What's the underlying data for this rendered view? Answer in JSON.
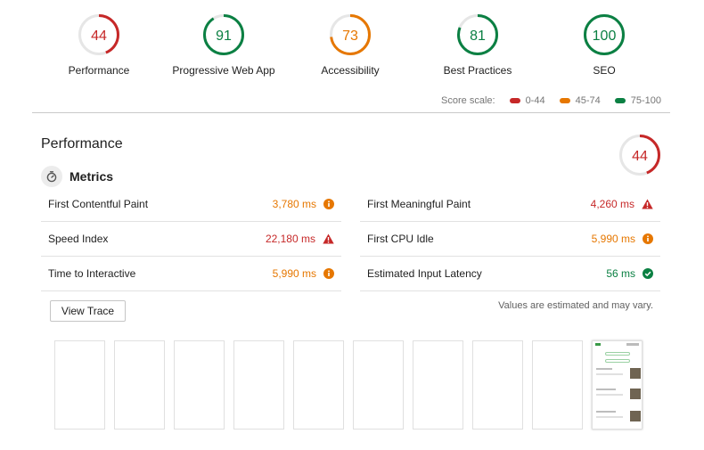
{
  "colors": {
    "pass": "#0b8043",
    "average": "#e67700",
    "fail": "#c62828",
    "track": "#e6e6e6"
  },
  "gauges": [
    {
      "score": 44,
      "label": "Performance",
      "rating": "fail"
    },
    {
      "score": 91,
      "label": "Progressive Web App",
      "rating": "pass"
    },
    {
      "score": 73,
      "label": "Accessibility",
      "rating": "average"
    },
    {
      "score": 81,
      "label": "Best Practices",
      "rating": "pass"
    },
    {
      "score": 100,
      "label": "SEO",
      "rating": "pass"
    }
  ],
  "score_scale": {
    "label": "Score scale:",
    "ranges": [
      {
        "text": "0-44",
        "rating": "fail"
      },
      {
        "text": "45-74",
        "rating": "average"
      },
      {
        "text": "75-100",
        "rating": "pass"
      }
    ]
  },
  "category": {
    "title": "Performance",
    "score": 44,
    "rating": "fail"
  },
  "metrics": {
    "title": "Metrics",
    "icon": "stopwatch-icon",
    "left": [
      {
        "label": "First Contentful Paint",
        "value": "3,780 ms",
        "rating": "average"
      },
      {
        "label": "Speed Index",
        "value": "22,180 ms",
        "rating": "fail"
      },
      {
        "label": "Time to Interactive",
        "value": "5,990 ms",
        "rating": "average"
      }
    ],
    "right": [
      {
        "label": "First Meaningful Paint",
        "value": "4,260 ms",
        "rating": "fail"
      },
      {
        "label": "First CPU Idle",
        "value": "5,990 ms",
        "rating": "average"
      },
      {
        "label": "Estimated Input Latency",
        "value": "56 ms",
        "rating": "pass"
      }
    ]
  },
  "view_trace_label": "View Trace",
  "estimate_note": "Values are estimated and may vary.",
  "filmstrip": {
    "frame_count": 10,
    "rendered_frame": "last"
  }
}
